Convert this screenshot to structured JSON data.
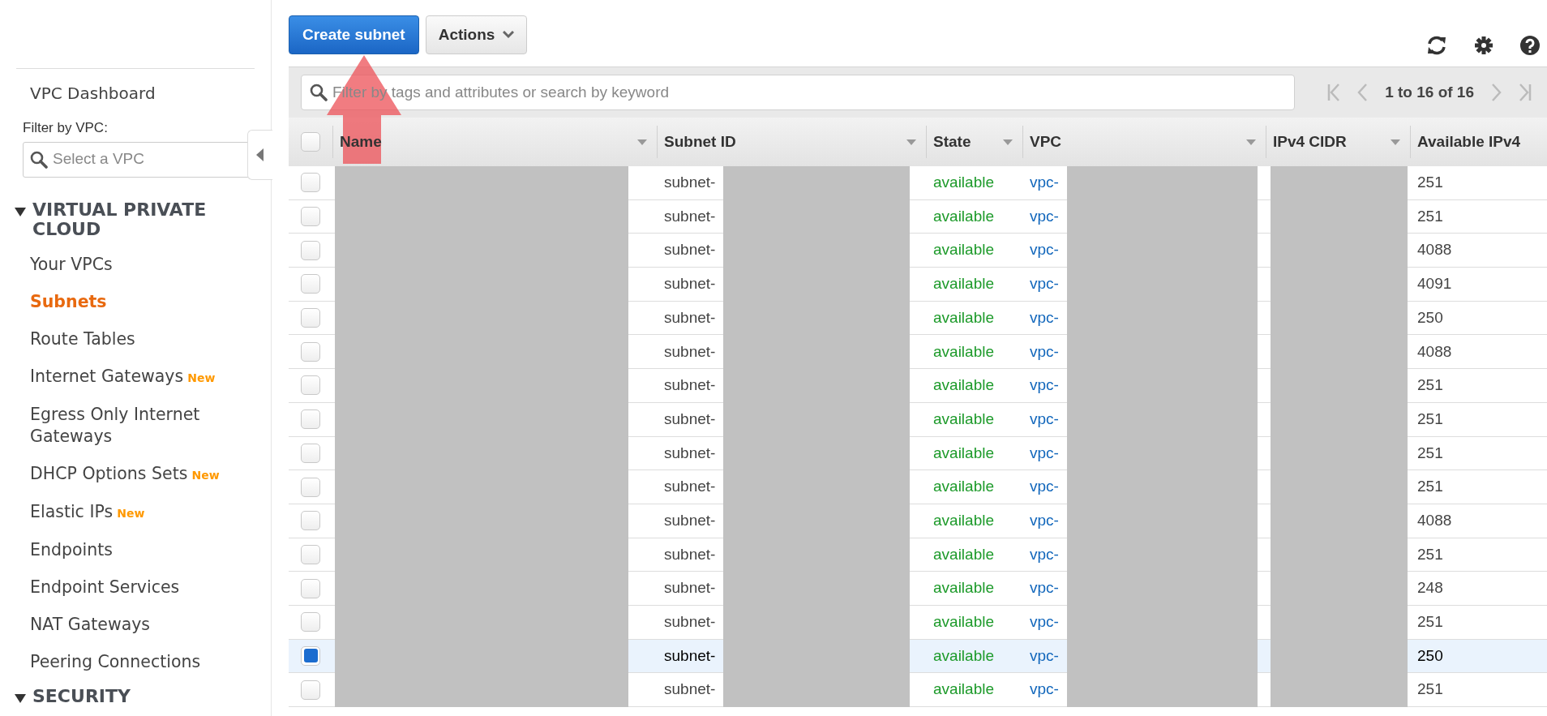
{
  "sidebar": {
    "dashboard": "VPC Dashboard",
    "filter_label": "Filter by VPC:",
    "filter_placeholder": "Select a VPC",
    "sections": [
      {
        "title": "VIRTUAL PRIVATE CLOUD",
        "expanded": true,
        "items": [
          {
            "label": "Your VPCs",
            "selected": false
          },
          {
            "label": "Subnets",
            "selected": true
          },
          {
            "label": "Route Tables",
            "selected": false
          },
          {
            "label": "Internet Gateways",
            "badge": "New",
            "selected": false
          },
          {
            "label": "Egress Only Internet Gateways",
            "selected": false
          },
          {
            "label": "DHCP Options Sets",
            "badge": "New",
            "selected": false
          },
          {
            "label": "Elastic IPs",
            "badge": "New",
            "selected": false
          },
          {
            "label": "Endpoints",
            "selected": false
          },
          {
            "label": "Endpoint Services",
            "selected": false
          },
          {
            "label": "NAT Gateways",
            "selected": false
          },
          {
            "label": "Peering Connections",
            "selected": false
          }
        ]
      },
      {
        "title": "SECURITY",
        "expanded": true
      }
    ]
  },
  "toolbar": {
    "create_button": "Create subnet",
    "actions_button": "Actions"
  },
  "search": {
    "placeholder": "Filter by tags and attributes or search by keyword"
  },
  "pagination": "1 to 16 of 16",
  "table": {
    "all_selected": false,
    "columns": [
      "Name",
      "Subnet ID",
      "State",
      "VPC",
      "IPv4 CIDR",
      "Available IPv4"
    ],
    "rows": [
      {
        "subnet_id": "subnet-",
        "state": "available",
        "vpc": "vpc-",
        "available_ipv4": "251",
        "selected": false
      },
      {
        "subnet_id": "subnet-",
        "state": "available",
        "vpc": "vpc-",
        "available_ipv4": "251",
        "selected": false
      },
      {
        "subnet_id": "subnet-",
        "state": "available",
        "vpc": "vpc-",
        "available_ipv4": "4088",
        "selected": false
      },
      {
        "subnet_id": "subnet-",
        "state": "available",
        "vpc": "vpc-",
        "available_ipv4": "4091",
        "selected": false
      },
      {
        "subnet_id": "subnet-",
        "state": "available",
        "vpc": "vpc-",
        "available_ipv4": "250",
        "selected": false
      },
      {
        "subnet_id": "subnet-",
        "state": "available",
        "vpc": "vpc-",
        "available_ipv4": "4088",
        "selected": false
      },
      {
        "subnet_id": "subnet-",
        "state": "available",
        "vpc": "vpc-",
        "available_ipv4": "251",
        "selected": false
      },
      {
        "subnet_id": "subnet-",
        "state": "available",
        "vpc": "vpc-",
        "available_ipv4": "251",
        "selected": false
      },
      {
        "subnet_id": "subnet-",
        "state": "available",
        "vpc": "vpc-",
        "available_ipv4": "251",
        "selected": false
      },
      {
        "subnet_id": "subnet-",
        "state": "available",
        "vpc": "vpc-",
        "available_ipv4": "251",
        "selected": false
      },
      {
        "subnet_id": "subnet-",
        "state": "available",
        "vpc": "vpc-",
        "available_ipv4": "4088",
        "selected": false
      },
      {
        "subnet_id": "subnet-",
        "state": "available",
        "vpc": "vpc-",
        "available_ipv4": "251",
        "selected": false
      },
      {
        "subnet_id": "subnet-",
        "state": "available",
        "vpc": "vpc-",
        "available_ipv4": "248",
        "selected": false
      },
      {
        "subnet_id": "subnet-",
        "state": "available",
        "vpc": "vpc-",
        "available_ipv4": "251",
        "selected": false
      },
      {
        "subnet_id": "subnet-",
        "state": "available",
        "vpc": "vpc-",
        "available_ipv4": "250",
        "selected": true
      },
      {
        "subnet_id": "subnet-",
        "state": "available",
        "vpc": "vpc-",
        "available_ipv4": "251",
        "selected": false
      }
    ]
  }
}
